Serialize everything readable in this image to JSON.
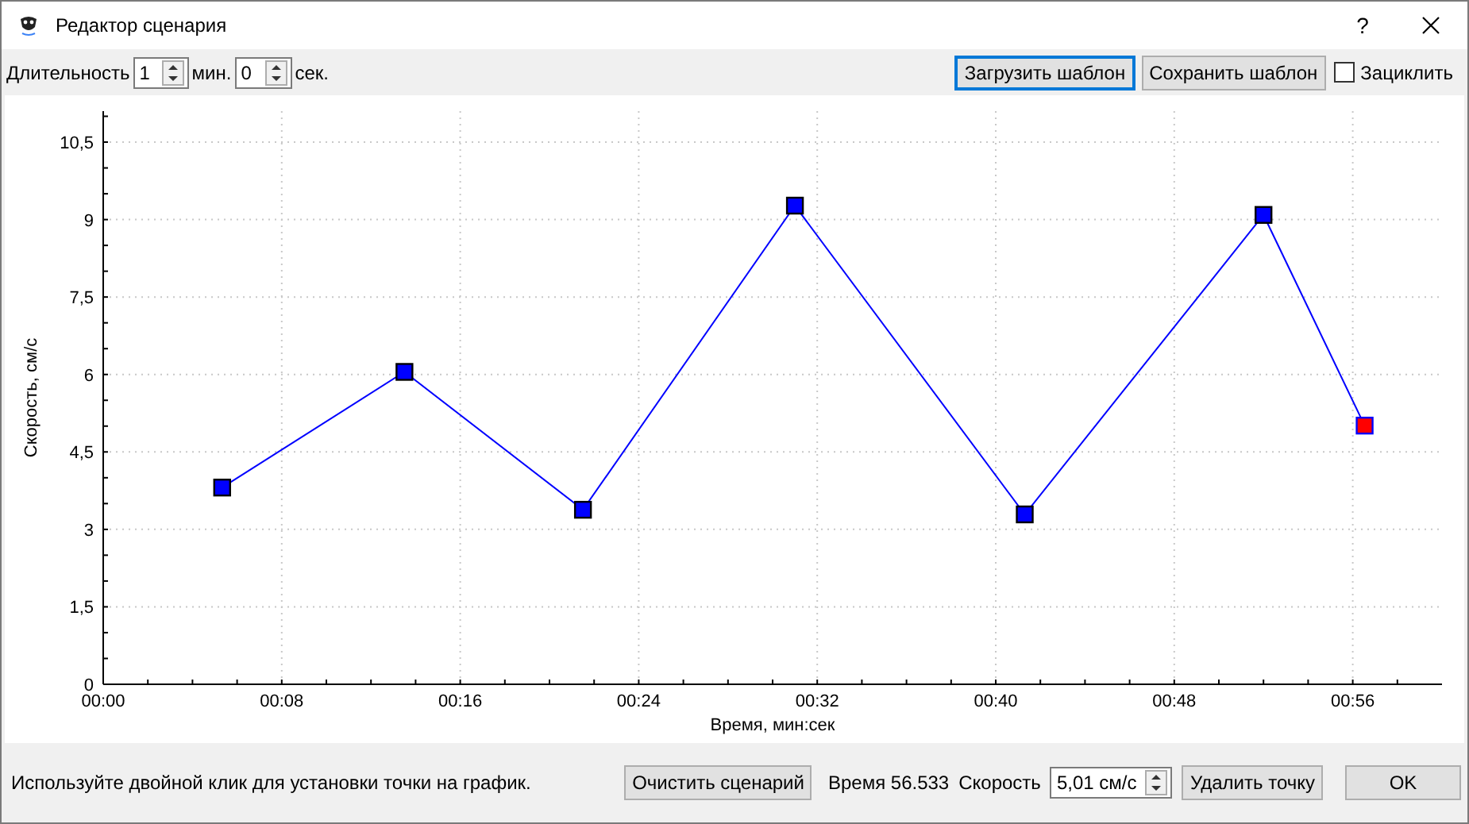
{
  "window": {
    "title": "Редактор сценария",
    "help": "?"
  },
  "toolbar": {
    "duration_label": "Длительность",
    "minutes": {
      "value": "1",
      "unit": "мин."
    },
    "seconds": {
      "value": "0",
      "unit": "сек."
    },
    "load_button": "Загрузить шаблон",
    "save_button": "Сохранить шаблон",
    "loop": {
      "label": "Зациклить",
      "checked": false
    }
  },
  "chart": {
    "chart_data": {
      "type": "line",
      "xlabel": "Время, мин:сек",
      "ylabel": "Скорость, см/с",
      "x": [
        5.33,
        13.5,
        21.5,
        31.0,
        41.3,
        52.0,
        56.533
      ],
      "grid": true,
      "series": [
        {
          "color": "#0000ff",
          "marker": "square",
          "values": [
            3.81,
            6.05,
            3.38,
            9.27,
            3.29,
            9.09,
            5.01
          ]
        }
      ],
      "xlim": [
        0,
        60
      ],
      "ylim": [
        0,
        11.1
      ],
      "xticks": [
        {
          "value": 0,
          "label": "00:00"
        },
        {
          "value": 8,
          "label": "00:08"
        },
        {
          "value": 16,
          "label": "00:16"
        },
        {
          "value": 24,
          "label": "00:24"
        },
        {
          "value": 32,
          "label": "00:32"
        },
        {
          "value": 40,
          "label": "00:40"
        },
        {
          "value": 48,
          "label": "00:48"
        },
        {
          "value": 56,
          "label": "00:56"
        }
      ],
      "yticks": [
        {
          "value": 0,
          "label": "0"
        },
        {
          "value": 1.5,
          "label": "1,5"
        },
        {
          "value": 3,
          "label": "3"
        },
        {
          "value": 4.5,
          "label": "4,5"
        },
        {
          "value": 6,
          "label": "6"
        },
        {
          "value": 7.5,
          "label": "7,5"
        },
        {
          "value": 9,
          "label": "9"
        },
        {
          "value": 10.5,
          "label": "10,5"
        }
      ]
    },
    "markers": [
      {
        "selected": false
      },
      {
        "selected": false
      },
      {
        "selected": false
      },
      {
        "selected": false
      },
      {
        "selected": false
      },
      {
        "selected": false
      },
      {
        "selected": true
      }
    ]
  },
  "footer": {
    "hint": "Используйте двойной клик для установки точки на график.",
    "clear_button": "Очистить сценарий",
    "time_text": "Время 56.533",
    "speed_label": "Скорость",
    "speed_value": "5,01 см/с",
    "delete_button": "Удалить точку",
    "ok_button": "OK"
  }
}
